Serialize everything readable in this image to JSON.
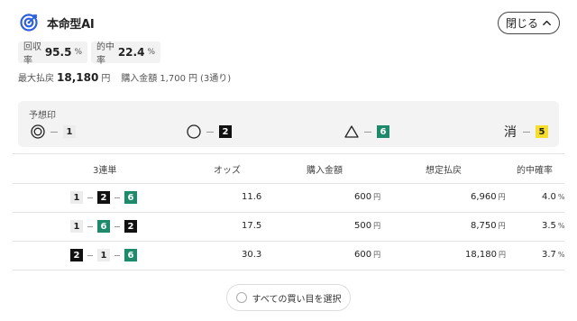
{
  "header": {
    "title": "本命型AI",
    "close_label": "閉じる",
    "close_icon": "chevron-up-icon",
    "logo_icon": "target-icon",
    "accent": "#2d5fe0"
  },
  "stats": [
    {
      "label": "回収率",
      "value": "95.5",
      "unit": "%"
    },
    {
      "label": "的中率",
      "value": "22.4",
      "unit": "%"
    }
  ],
  "summary": {
    "max_label": "最大払戻",
    "max_value": "18,180",
    "max_unit": "円",
    "purchase_label": "購入金額",
    "purchase_value": "1,700",
    "purchase_unit": "円",
    "purchase_note": "(3通り)"
  },
  "prediction": {
    "label": "予想印",
    "marks": [
      {
        "symbol": "double-circle-icon",
        "number": "1"
      },
      {
        "symbol": "circle-icon",
        "number": "2"
      },
      {
        "symbol": "triangle-icon",
        "number": "6"
      },
      {
        "symbol": "消",
        "number": "5"
      }
    ]
  },
  "table": {
    "headers": [
      "3連単",
      "オッズ",
      "購入金額",
      "想定払戻",
      "的中確率"
    ],
    "rows": [
      {
        "combo": [
          "1",
          "2",
          "6"
        ],
        "odds": "11.6",
        "amount": "600",
        "payout": "6,960",
        "prob": "4.0"
      },
      {
        "combo": [
          "1",
          "6",
          "2"
        ],
        "odds": "17.5",
        "amount": "500",
        "payout": "8,750",
        "prob": "3.5"
      },
      {
        "combo": [
          "2",
          "1",
          "6"
        ],
        "odds": "30.3",
        "amount": "600",
        "payout": "18,180",
        "prob": "3.7"
      }
    ],
    "yen": "円",
    "percent": "%"
  },
  "select_all_label": "すべての買い目を選択",
  "boat_colors": {
    "1": "#ececec",
    "2": "#111111",
    "5": "#f5de2e",
    "6": "#1f8a6b"
  }
}
